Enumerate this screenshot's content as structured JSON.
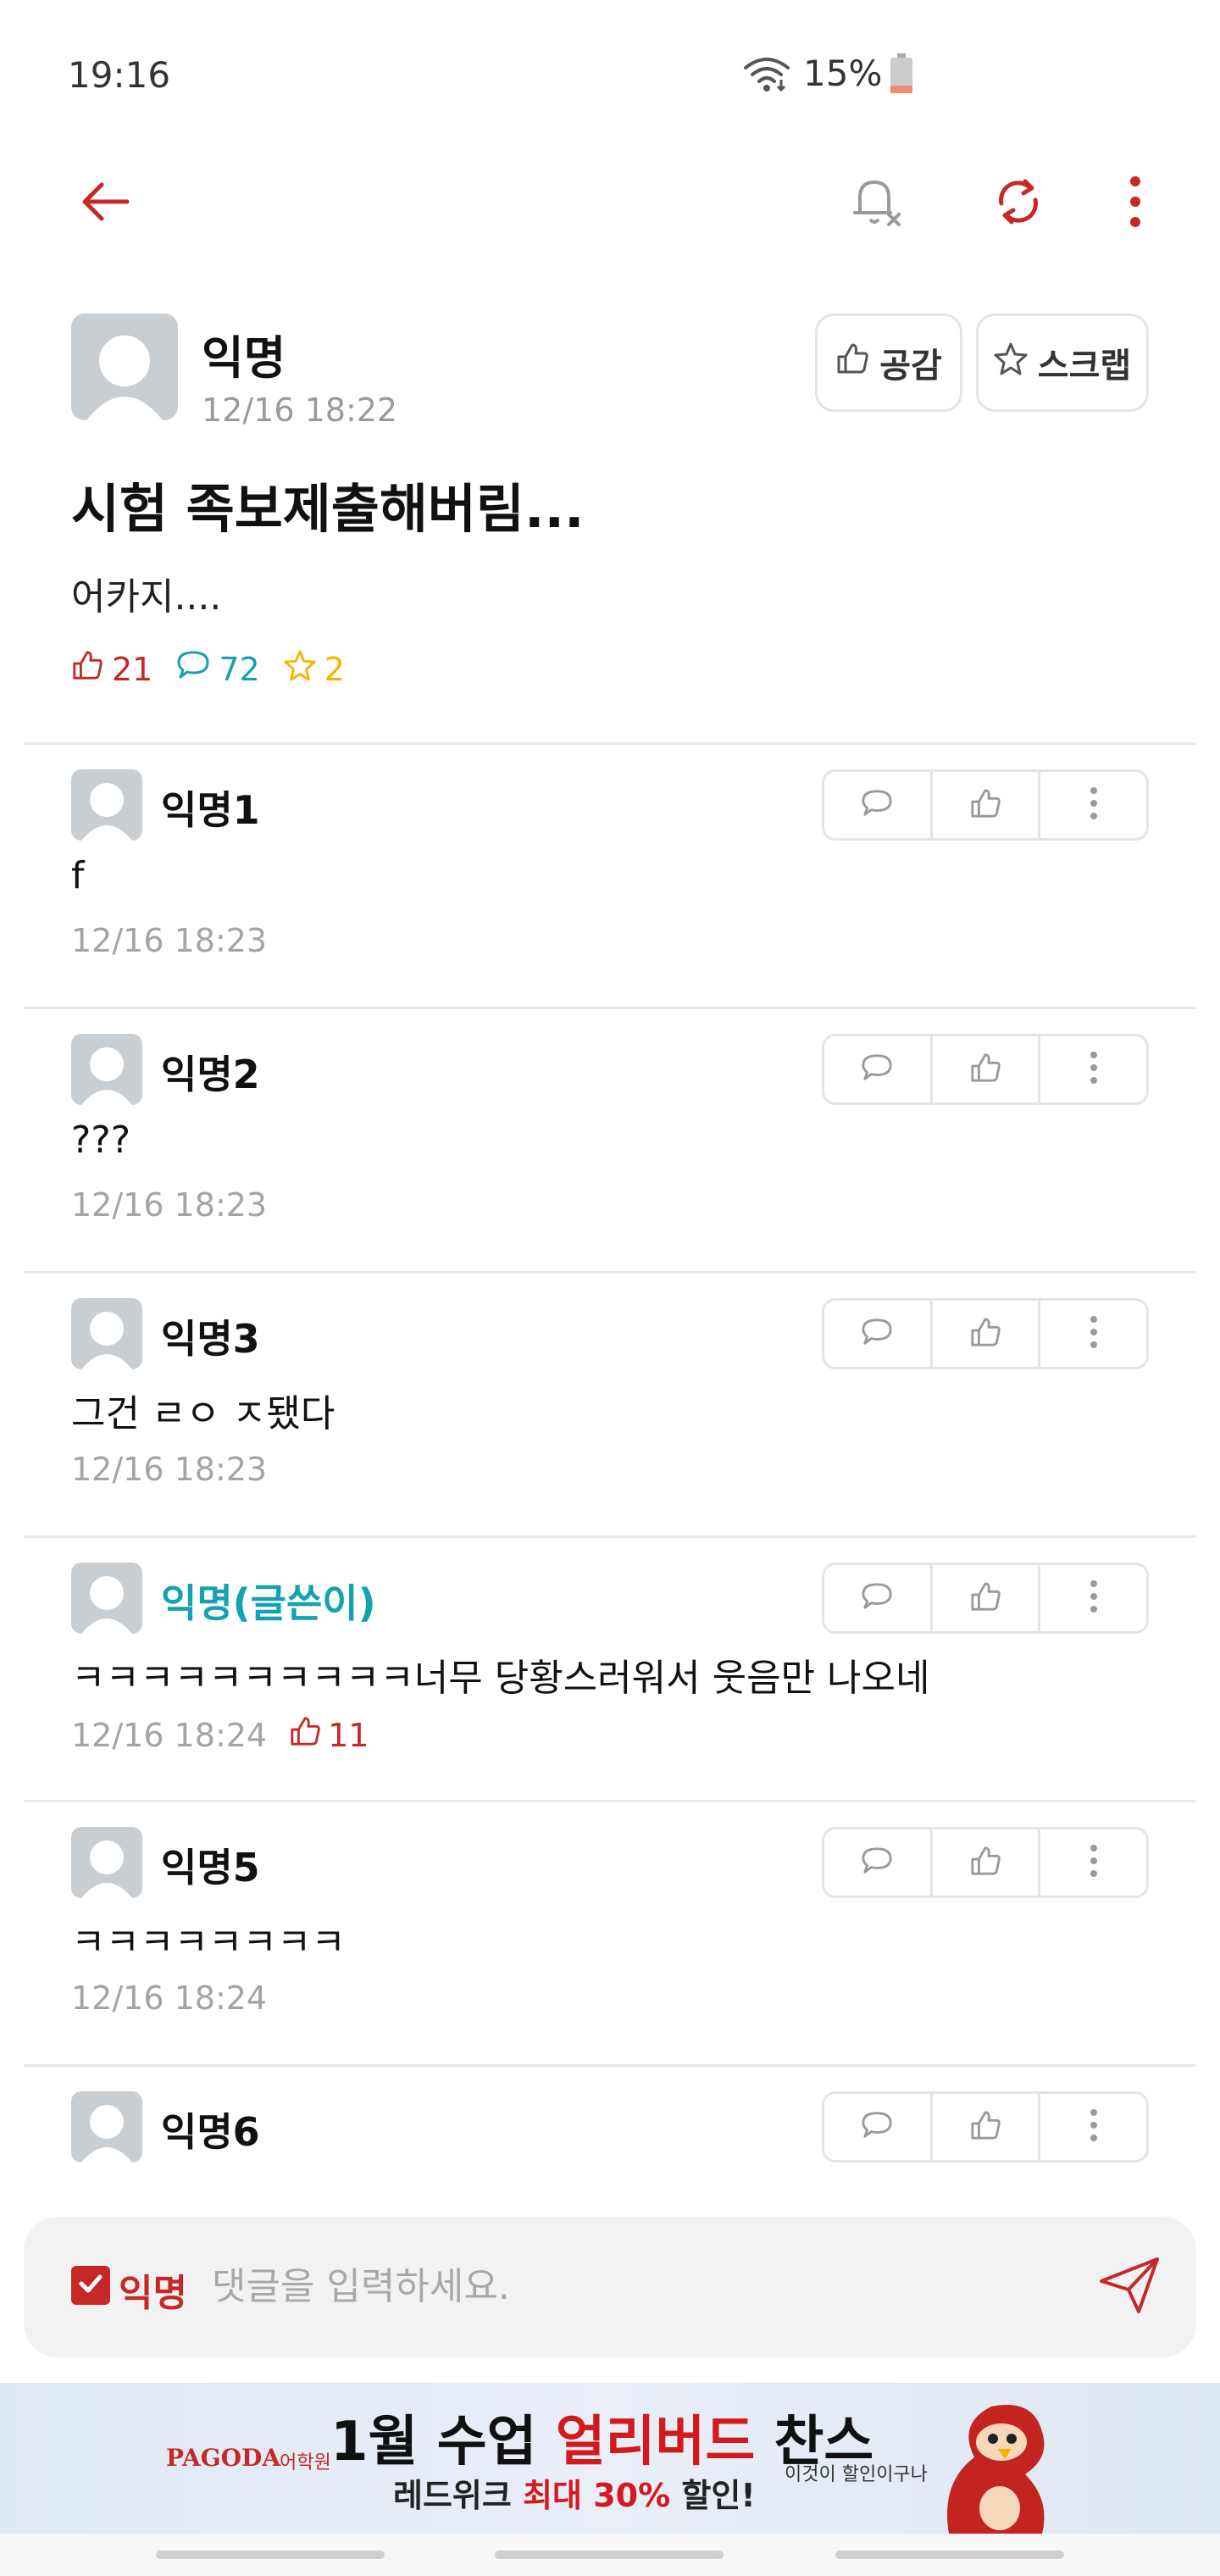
{
  "status_bar": {
    "time": "19:16",
    "battery": "15%"
  },
  "post": {
    "author": "익명",
    "time": "12/16 18:22",
    "like_button": "공감",
    "scrap_button": "스크랩",
    "title": "시험 족보제출해버림...",
    "body": "어카지....",
    "likes": "21",
    "comments": "72",
    "scraps": "2"
  },
  "comments": [
    {
      "name": "익명1",
      "text": "f",
      "time": "12/16 18:23",
      "likes": ""
    },
    {
      "name": "익명2",
      "text": "???",
      "time": "12/16 18:23",
      "likes": ""
    },
    {
      "name": "익명3",
      "text": "그건 ㄹㅇ ㅈ됐다",
      "time": "12/16 18:23",
      "likes": ""
    },
    {
      "name": "익명(글쓴이)",
      "text": "ㅋㅋㅋㅋㅋㅋㅋㅋㅋㅋ너무 당황스러워서 웃음만 나오네",
      "time": "12/16 18:24",
      "likes": "11"
    },
    {
      "name": "익명5",
      "text": "ㅋㅋㅋㅋㅋㅋㅋㅋ",
      "time": "12/16 18:24",
      "likes": ""
    },
    {
      "name": "익명6",
      "text": "",
      "time": "",
      "likes": ""
    }
  ],
  "comment_input": {
    "anon_label": "익명",
    "placeholder": "댓글을 입력하세요."
  },
  "ad": {
    "brand": "PAGODA",
    "brand_sub": "어학원",
    "headline_pre": "1월 수업 ",
    "headline_hl": "얼리버드",
    "headline_post": " 찬스",
    "sub_pre": "레드위크 ",
    "sub_hl": "최대 30%",
    "sub_post": " 할인!",
    "note": "이것이 할인이구나"
  },
  "colors": {
    "accent": "#c62828",
    "op_name": "#14a2ae",
    "comment_count": "#14a2ae",
    "scrap_star": "#f5b400"
  },
  "icons": [
    "back-arrow-icon",
    "bell-off-icon",
    "refresh-icon",
    "more-vertical-icon",
    "thumbs-up-icon",
    "star-icon",
    "comment-bubble-icon",
    "send-icon",
    "wifi-icon",
    "battery-icon"
  ]
}
